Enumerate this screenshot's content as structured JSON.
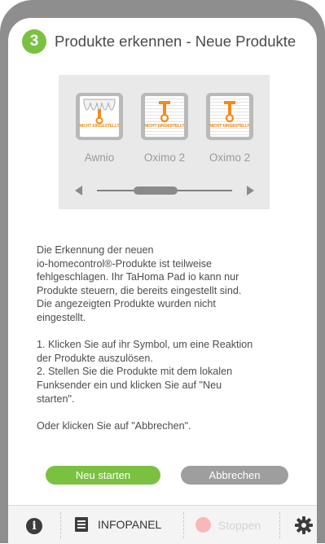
{
  "step": {
    "number": "3",
    "title": "Produkte erkennen - Neue Produkte"
  },
  "products": [
    {
      "name": "Awnio",
      "status": "NICHT EINGESTELLT",
      "icon": "awning-icon"
    },
    {
      "name": "Oximo 2",
      "status": "NICHT EINGESTELLT",
      "icon": "roller-shutter-icon"
    },
    {
      "name": "Oximo 2",
      "status": "NICHT EINGESTELLT",
      "icon": "roller-shutter-icon"
    }
  ],
  "description": [
    "Die Erkennung der neuen\nio-homecontrol®-Produkte ist teilweise\nfehlgeschlagen. Ihr TaHoma Pad io kann nur\nProdukte steuern, die bereits eingestellt sind.\nDie angezeigten Produkte wurden nicht\neingestellt.",
    "1. Klicken Sie auf ihr Symbol, um eine Reaktion\nder Produkte auszulösen.\n2. Stellen Sie die Produkte mit dem lokalen\nFunksender ein und klicken Sie auf \"Neu\nstarten\".",
    "Oder klicken Sie auf \"Abbrechen\"."
  ],
  "buttons": {
    "restart": "Neu starten",
    "cancel": "Abbrechen"
  },
  "footer": {
    "infopanel": "INFOPANEL",
    "stop": "Stoppen"
  },
  "colors": {
    "accent": "#7ac142",
    "orange": "#f28c18",
    "stop": "#f7b8b8",
    "grey_button": "#9e9e9e"
  }
}
